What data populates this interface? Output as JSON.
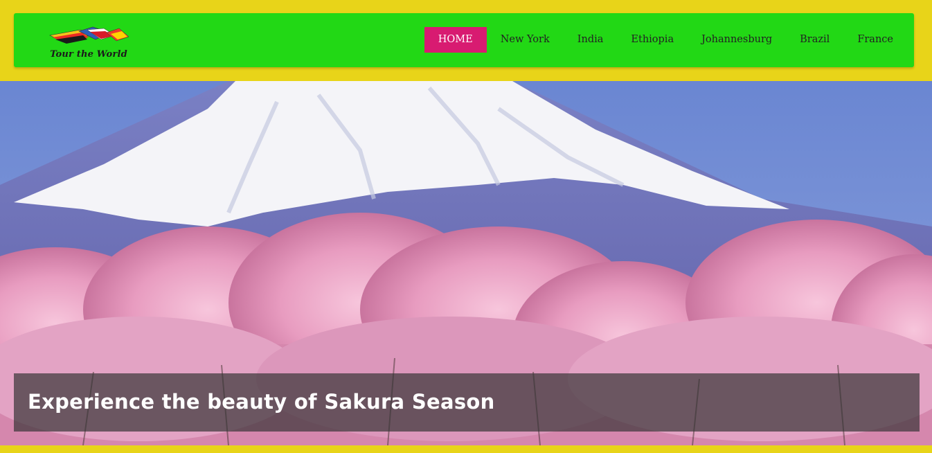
{
  "brand": {
    "logo_text": "Tour the World"
  },
  "nav": {
    "items": [
      {
        "label": "HOME",
        "active": true
      },
      {
        "label": "New York"
      },
      {
        "label": "India"
      },
      {
        "label": "Ethiopia"
      },
      {
        "label": "Johannesburg"
      },
      {
        "label": "Brazil"
      },
      {
        "label": "France"
      }
    ]
  },
  "hero": {
    "caption": "Experience the beauty of Sakura Season"
  },
  "colors": {
    "page_background": "#e8d419",
    "navbar": "#22d815",
    "active_nav": "#d81b71"
  }
}
